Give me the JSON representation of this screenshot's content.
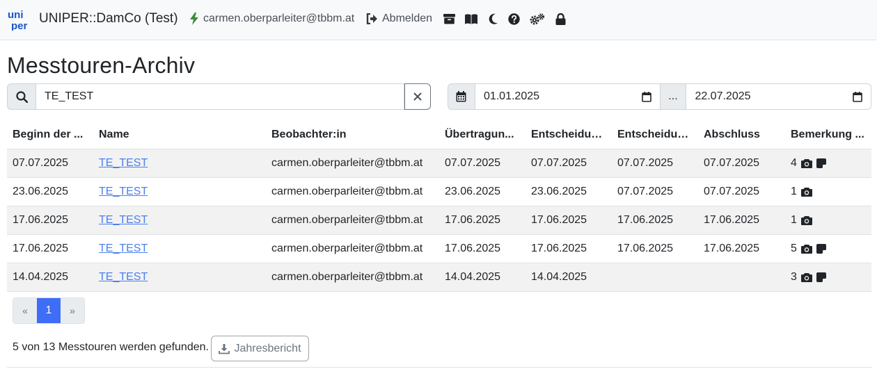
{
  "navbar": {
    "logo_line1": "uni",
    "logo_line2": "per",
    "title": "UNIPER::DamCo (Test)",
    "user_email": "carmen.oberparleiter@tbbm.at",
    "logout_label": "Abmelden",
    "icons": [
      "archive-icon",
      "book-icon",
      "moon-icon",
      "question-icon",
      "cogs-icon",
      "lock-icon"
    ]
  },
  "page": {
    "title": "Messtouren-Archiv"
  },
  "search": {
    "value": "TE_TEST"
  },
  "date_filter": {
    "from": "01.01.2025",
    "separator": "...",
    "to": "22.07.2025"
  },
  "table": {
    "headers": [
      "Beginn der ...",
      "Name",
      "Beobachter:in",
      "Übertragun...",
      "Entscheidun...",
      "Entscheidun...",
      "Abschluss",
      "Bemerkung ..."
    ],
    "rows": [
      {
        "start": "07.07.2025",
        "name": "TE_TEST",
        "observer": "carmen.oberparleiter@tbbm.at",
        "transfer": "07.07.2025",
        "decision1": "07.07.2025",
        "decision2": "07.07.2025",
        "closing": "07.07.2025",
        "remark_count": "4"
      },
      {
        "start": "23.06.2025",
        "name": "TE_TEST",
        "observer": "carmen.oberparleiter@tbbm.at",
        "transfer": "23.06.2025",
        "decision1": "23.06.2025",
        "decision2": "07.07.2025",
        "closing": "07.07.2025",
        "remark_count": "1"
      },
      {
        "start": "17.06.2025",
        "name": "TE_TEST",
        "observer": "carmen.oberparleiter@tbbm.at",
        "transfer": "17.06.2025",
        "decision1": "17.06.2025",
        "decision2": "17.06.2025",
        "closing": "17.06.2025",
        "remark_count": "1"
      },
      {
        "start": "17.06.2025",
        "name": "TE_TEST",
        "observer": "carmen.oberparleiter@tbbm.at",
        "transfer": "17.06.2025",
        "decision1": "17.06.2025",
        "decision2": "17.06.2025",
        "closing": "17.06.2025",
        "remark_count": "5"
      },
      {
        "start": "14.04.2025",
        "name": "TE_TEST",
        "observer": "carmen.oberparleiter@tbbm.at",
        "transfer": "14.04.2025",
        "decision1": "14.04.2025",
        "decision2": "",
        "closing": "",
        "remark_count": "3"
      }
    ]
  },
  "pagination": {
    "prev": "«",
    "current": "1",
    "next": "»"
  },
  "footer": {
    "result_text": "5 von 13 Messtouren werden gefunden.",
    "report_label": "Jahresbericht"
  },
  "colors": {
    "navbar_bg": "#f8f9fa",
    "brand_blue": "#1a56c4",
    "link": "#4a7ff0",
    "active_page": "#3d6ef5",
    "user_icon_green": "#3a8a3a"
  }
}
